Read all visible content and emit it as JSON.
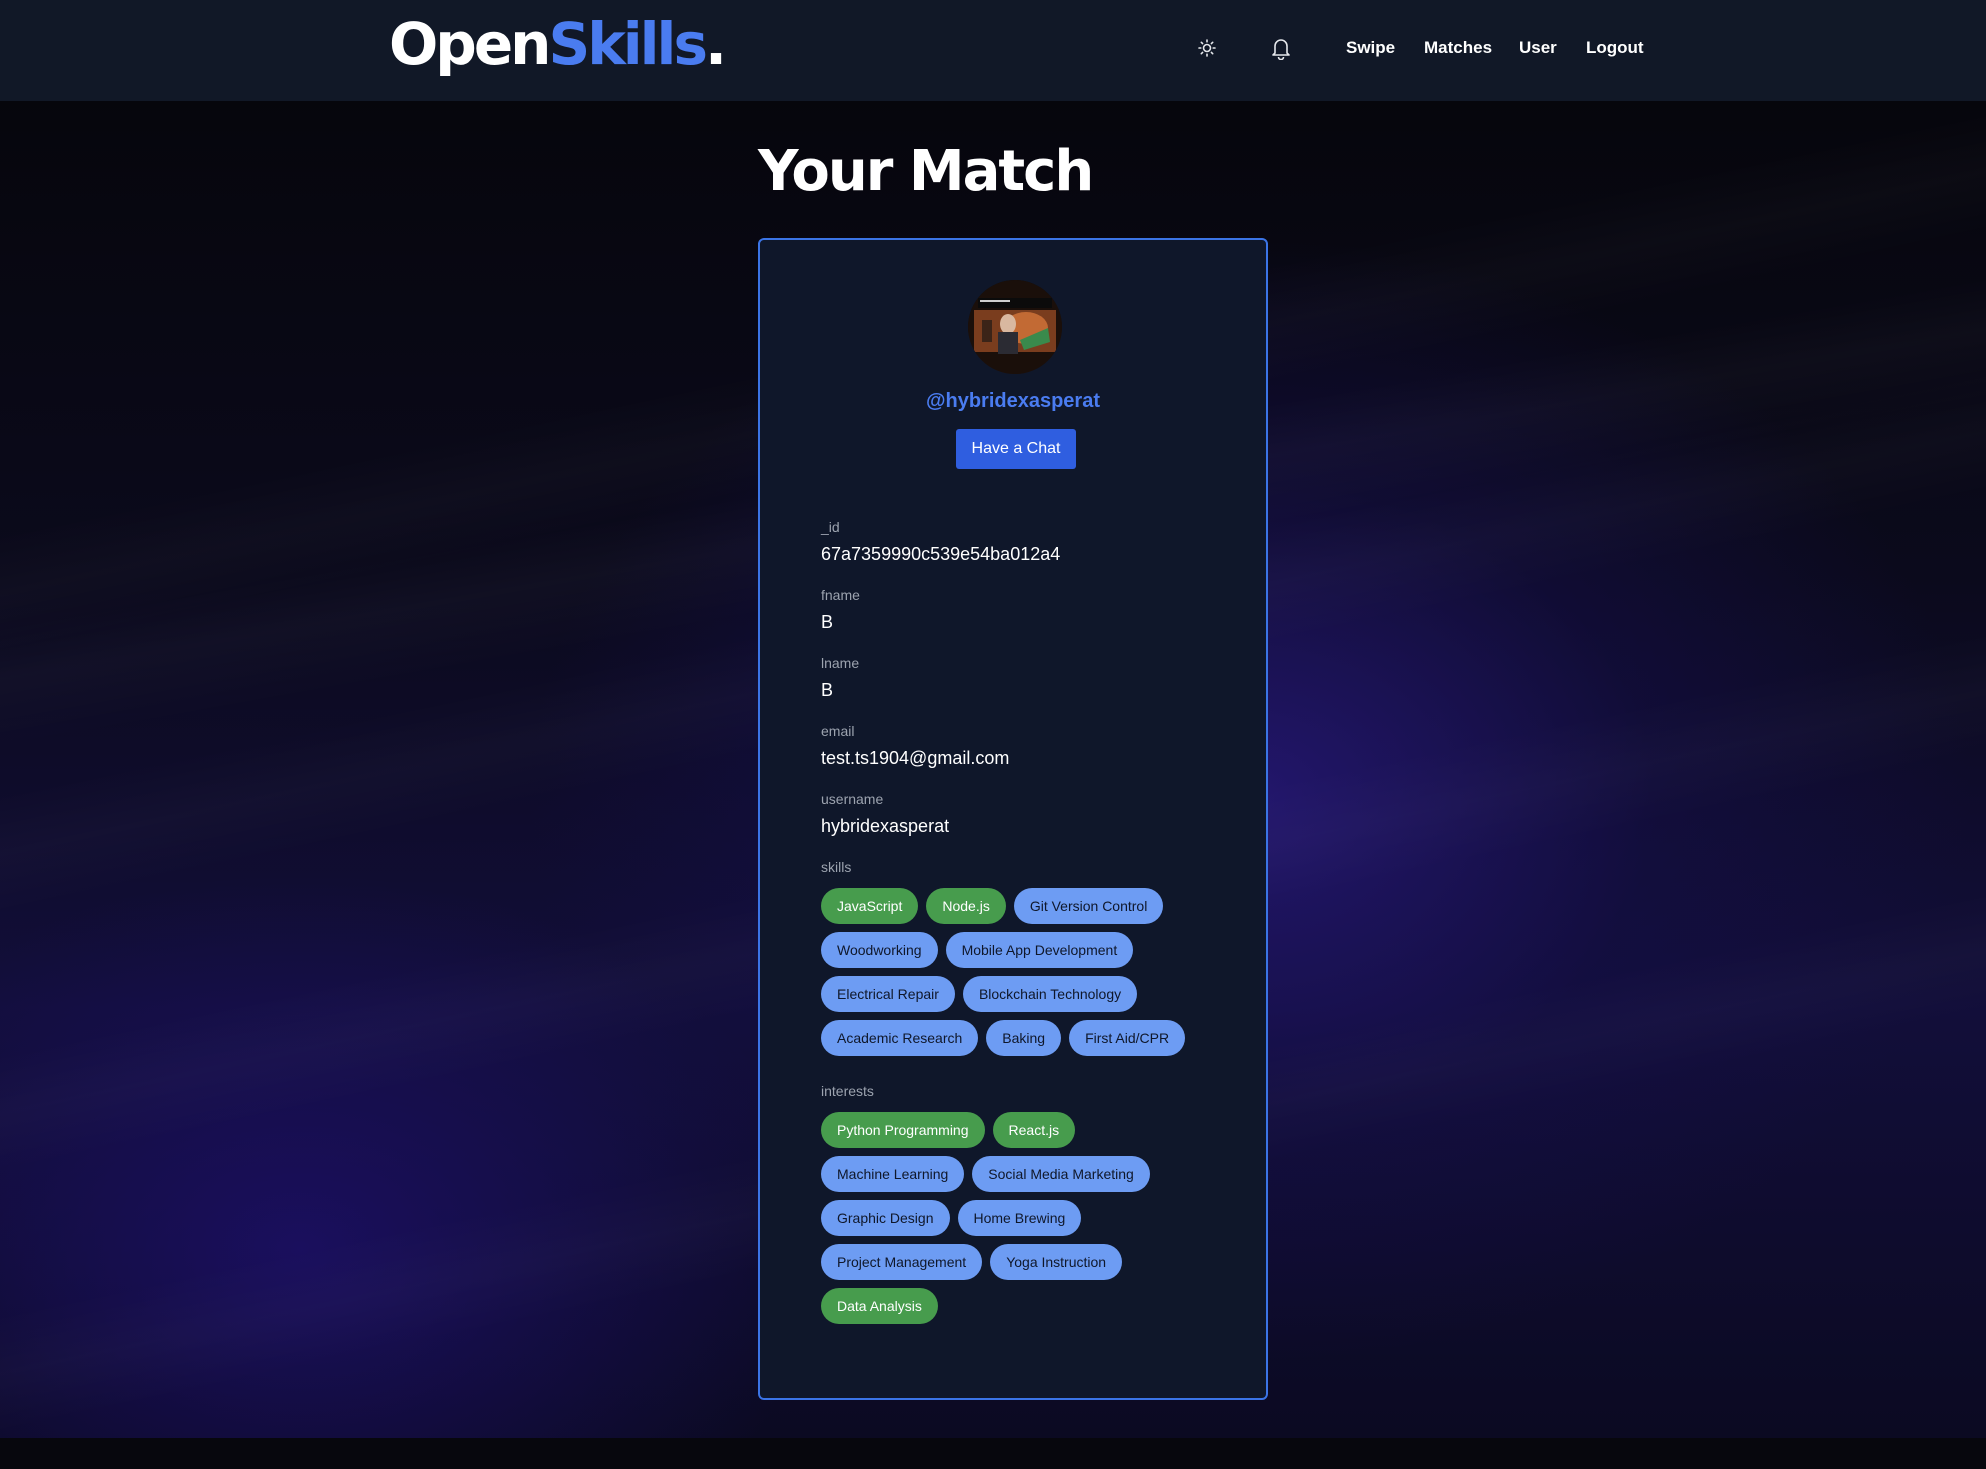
{
  "brand": {
    "part1": "Open",
    "part2": "Skills",
    "part3": "."
  },
  "nav": {
    "theme_icon": "sun-icon",
    "notifications_icon": "bell-icon",
    "links": [
      "Swipe",
      "Matches",
      "User",
      "Logout"
    ]
  },
  "page": {
    "title": "Your Match"
  },
  "profile": {
    "handle": "@hybridexasperat",
    "chat_button": "Have a Chat",
    "fields": [
      {
        "label": "_id",
        "value": "67a7359990c539e54ba012a4"
      },
      {
        "label": "fname",
        "value": "B"
      },
      {
        "label": "lname",
        "value": "B"
      },
      {
        "label": "email",
        "value": "test.ts1904@gmail.com"
      },
      {
        "label": "username",
        "value": "hybridexasperat"
      }
    ],
    "skills_label": "skills",
    "skills": [
      [
        "JavaScript",
        "Node.js",
        "Git Version Control"
      ],
      [
        "Woodworking",
        "Mobile App Development"
      ],
      [
        "Electrical Repair",
        "Blockchain Technology"
      ],
      [
        "Academic Research",
        "Baking",
        "First Aid/CPR"
      ]
    ],
    "skills_matched": [
      "JavaScript",
      "Node.js"
    ],
    "interests_label": "interests",
    "interests": [
      [
        "Python Programming",
        "React.js"
      ],
      [
        "Machine Learning",
        "Social Media Marketing"
      ],
      [
        "Graphic Design",
        "Home Brewing"
      ],
      [
        "Project Management",
        "Yoga Instruction"
      ],
      [
        "Data Analysis"
      ]
    ],
    "interests_matched": [
      "Python Programming",
      "React.js",
      "Data Analysis"
    ]
  },
  "colors": {
    "accent": "#4a7cf0",
    "button": "#2f5ee0",
    "matched_tag": "#479c4d",
    "tag": "#6d9cf3",
    "card_border": "#3b74e6",
    "header_bg": "#111827"
  }
}
